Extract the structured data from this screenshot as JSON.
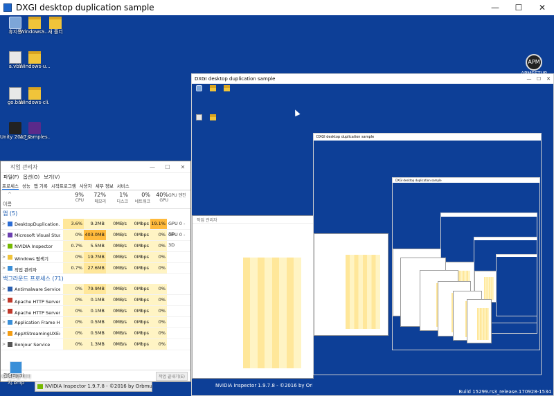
{
  "window": {
    "title": "DXGI desktop duplication sample",
    "min": "—",
    "max": "☐",
    "close": "✕"
  },
  "desktop_icons": [
    {
      "label": "휴지통",
      "kind": "bin"
    },
    {
      "label": "WindowsS...",
      "kind": "folder"
    },
    {
      "label": "새 폴더",
      "kind": "folder"
    },
    {
      "label": "a.vbs",
      "kind": "doc"
    },
    {
      "label": "Windows-u...",
      "kind": "folder"
    },
    {
      "label": "go.bat",
      "kind": "doc"
    },
    {
      "label": "Windows-cli...",
      "kind": "folder"
    },
    {
      "label": "Unity 2017.2.0...",
      "kind": "unity"
    },
    {
      "label": "vc_samples...",
      "kind": "vcs"
    }
  ],
  "apmsetup": {
    "glyph": "APM",
    "label": "APMSETUP"
  },
  "task_manager": {
    "title": "작업 관리자",
    "menu": [
      "파일(F)",
      "옵션(O)",
      "보기(V)"
    ],
    "tabs": [
      "프로세스",
      "성능",
      "앱 기록",
      "시작프로그램",
      "사용자",
      "세부 정보",
      "서비스"
    ],
    "columns": [
      {
        "pct": "9%",
        "name": "CPU"
      },
      {
        "pct": "72%",
        "name": "메모리"
      },
      {
        "pct": "1%",
        "name": "디스크"
      },
      {
        "pct": "0%",
        "name": "네트워크"
      },
      {
        "pct": "40%",
        "name": "GPU"
      },
      {
        "pct": "",
        "name": "GPU 엔진"
      }
    ],
    "name_header": "이름",
    "apps_section": "앱 (5)",
    "apps": [
      {
        "name": "DesktopDuplication.exe(32...",
        "cpu": "3.6%",
        "mem": "9.2MB",
        "disk": "0MB/s",
        "net": "0Mbps",
        "gpu": "19.1%",
        "engine": "GPU 0 - 3D"
      },
      {
        "name": "Microsoft Visual Studio 20...",
        "cpu": "0%",
        "mem": "403.0MB",
        "disk": "0MB/s",
        "net": "0Mbps",
        "gpu": "0%",
        "engine": "GPU 0 - 3D"
      },
      {
        "name": "NVIDIA Inspector",
        "cpu": "0.7%",
        "mem": "5.5MB",
        "disk": "0MB/s",
        "net": "0Mbps",
        "gpu": "0%",
        "engine": ""
      },
      {
        "name": "Windows 탐색기",
        "cpu": "0%",
        "mem": "19.7MB",
        "disk": "0MB/s",
        "net": "0Mbps",
        "gpu": "0%",
        "engine": ""
      },
      {
        "name": "작업 관리자",
        "cpu": "0.7%",
        "mem": "27.6MB",
        "disk": "0MB/s",
        "net": "0Mbps",
        "gpu": "0%",
        "engine": ""
      }
    ],
    "bg_section": "백그라운드 프로세스 (71)",
    "background": [
      {
        "name": "Antimalware Service Execut...",
        "cpu": "0%",
        "mem": "79.9MB",
        "disk": "0MB/s",
        "net": "0Mbps",
        "gpu": "0%",
        "engine": ""
      },
      {
        "name": "Apache HTTP Server(32비트)",
        "cpu": "0%",
        "mem": "0.1MB",
        "disk": "0MB/s",
        "net": "0Mbps",
        "gpu": "0%",
        "engine": ""
      },
      {
        "name": "Apache HTTP Server(32비트)",
        "cpu": "0%",
        "mem": "0.1MB",
        "disk": "0MB/s",
        "net": "0Mbps",
        "gpu": "0%",
        "engine": ""
      },
      {
        "name": "Application Frame Host",
        "cpu": "0%",
        "mem": "0.5MB",
        "disk": "0MB/s",
        "net": "0Mbps",
        "gpu": "0%",
        "engine": ""
      },
      {
        "name": "AppXStreamingUXExe",
        "cpu": "0%",
        "mem": "0.5MB",
        "disk": "0MB/s",
        "net": "0Mbps",
        "gpu": "0%",
        "engine": ""
      },
      {
        "name": "Bonjour Service",
        "cpu": "0%",
        "mem": "1.3MB",
        "disk": "0MB/s",
        "net": "0Mbps",
        "gpu": "0%",
        "engine": ""
      }
    ],
    "brief": "간단히(D)",
    "end_task": "작업 끝내기(E)"
  },
  "bottom_icon": {
    "label": "새 비트맵 이미지.bmp"
  },
  "nvidia_bar": "NVIDIA Inspector 1.9.7.8 - ©2016 by Orbmu2k - [GPU (#1)]",
  "build_info": "Build 15299.rs3_release.170928-1534",
  "nested_title": "DXGI desktop duplication sample",
  "nested_tm_title": "작업 관리자"
}
